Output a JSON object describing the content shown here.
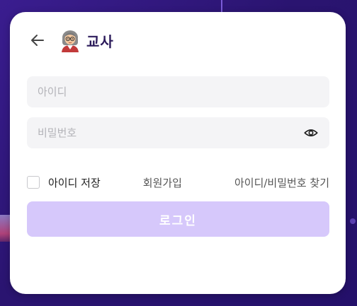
{
  "header": {
    "title": "교사",
    "back_icon": "arrow-left-icon",
    "avatar_icon": "teacher-emoji-icon"
  },
  "form": {
    "id_placeholder": "아이디",
    "password_placeholder": "비밀번호",
    "password_toggle_icon": "eye-icon",
    "remember_label": "아이디 저장",
    "remember_checked": false,
    "signup_label": "회원가입",
    "find_label": "아이디/비밀번호 찾기",
    "login_label": "로그인"
  },
  "colors": {
    "background": "#2a1470",
    "card": "#ffffff",
    "field": "#f4f4f6",
    "login_button": "#d6c8fb",
    "title": "#2b1a5a"
  }
}
